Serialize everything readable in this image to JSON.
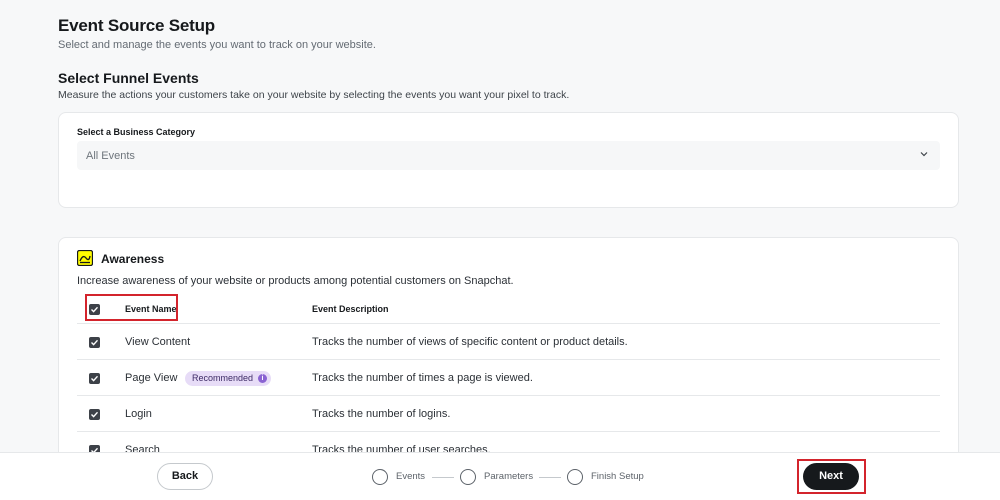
{
  "header": {
    "title": "Event Source Setup",
    "subtitle": "Select and manage the events you want to track on your website."
  },
  "funnel": {
    "title": "Select Funnel Events",
    "subtitle": "Measure the actions your customers take on your website by selecting the events you want your pixel to track."
  },
  "category": {
    "label": "Select a Business Category",
    "value": "All Events"
  },
  "awareness": {
    "title": "Awareness",
    "description": "Increase awareness of your website or products among potential customers on Snapchat.",
    "columns": {
      "name": "Event Name",
      "description": "Event Description"
    },
    "rows": [
      {
        "name": "View Content",
        "description": "Tracks the number of views of specific content or product details.",
        "checked": true
      },
      {
        "name": "Page View",
        "badge": "Recommended",
        "description": "Tracks the number of times a page is viewed.",
        "checked": true
      },
      {
        "name": "Login",
        "description": "Tracks the number of logins.",
        "checked": true
      },
      {
        "name": "Search",
        "description": "Tracks the number of user searches.",
        "checked": true
      }
    ]
  },
  "footer": {
    "back_label": "Back",
    "next_label": "Next",
    "steps": [
      {
        "label": "Events"
      },
      {
        "label": "Parameters"
      },
      {
        "label": "Finish Setup"
      }
    ]
  },
  "icons": {
    "chevron": "chevron-down-icon",
    "awareness": "awareness-icon",
    "check": "check-icon",
    "info": "info-icon"
  },
  "colors": {
    "accent": "#16191c",
    "highlight": "#d3242c",
    "badge_bg": "#e7dcf7",
    "awareness_icon": "#fffc00"
  }
}
